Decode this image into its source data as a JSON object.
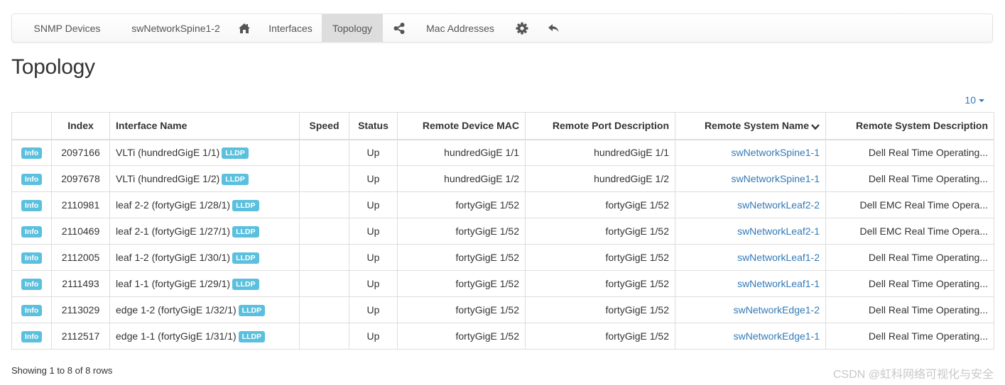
{
  "nav": {
    "snmp_devices": "SNMP Devices",
    "device_name": "swNetworkSpine1-2",
    "home_icon": "home-icon",
    "interfaces": "Interfaces",
    "topology": "Topology",
    "share_icon": "share-icon",
    "mac_addresses": "Mac Addresses",
    "gear_icon": "gear-icon",
    "back_icon": "reply-icon"
  },
  "page_title": "Topology",
  "page_size": "10",
  "table": {
    "columns": [
      "",
      "Index",
      "Interface Name",
      "Speed",
      "Status",
      "Remote Device MAC",
      "Remote Port Description",
      "Remote System Name",
      "Remote System Description"
    ],
    "info_label": "Info",
    "lldp_label": "LLDP",
    "rows": [
      {
        "index": "2097166",
        "iface": "VLTi (hundredGigE 1/1)",
        "speed": "",
        "status": "Up",
        "mac": "hundredGigE 1/1",
        "port_desc": "hundredGigE 1/1",
        "sys_name": "swNetworkSpine1-1",
        "sys_desc": "Dell Real Time Operating..."
      },
      {
        "index": "2097678",
        "iface": "VLTi (hundredGigE 1/2)",
        "speed": "",
        "status": "Up",
        "mac": "hundredGigE 1/2",
        "port_desc": "hundredGigE 1/2",
        "sys_name": "swNetworkSpine1-1",
        "sys_desc": "Dell Real Time Operating..."
      },
      {
        "index": "2110981",
        "iface": "leaf 2-2 (fortyGigE 1/28/1)",
        "speed": "",
        "status": "Up",
        "mac": "fortyGigE 1/52",
        "port_desc": "fortyGigE 1/52",
        "sys_name": "swNetworkLeaf2-2",
        "sys_desc": "Dell EMC Real Time Opera..."
      },
      {
        "index": "2110469",
        "iface": "leaf 2-1 (fortyGigE 1/27/1)",
        "speed": "",
        "status": "Up",
        "mac": "fortyGigE 1/52",
        "port_desc": "fortyGigE 1/52",
        "sys_name": "swNetworkLeaf2-1",
        "sys_desc": "Dell EMC Real Time Opera..."
      },
      {
        "index": "2112005",
        "iface": "leaf 1-2 (fortyGigE 1/30/1)",
        "speed": "",
        "status": "Up",
        "mac": "fortyGigE 1/52",
        "port_desc": "fortyGigE 1/52",
        "sys_name": "swNetworkLeaf1-2",
        "sys_desc": "Dell Real Time Operating..."
      },
      {
        "index": "2111493",
        "iface": "leaf 1-1 (fortyGigE 1/29/1)",
        "speed": "",
        "status": "Up",
        "mac": "fortyGigE 1/52",
        "port_desc": "fortyGigE 1/52",
        "sys_name": "swNetworkLeaf1-1",
        "sys_desc": "Dell Real Time Operating..."
      },
      {
        "index": "2113029",
        "iface": "edge 1-2 (fortyGigE 1/32/1)",
        "speed": "",
        "status": "Up",
        "mac": "fortyGigE 1/52",
        "port_desc": "fortyGigE 1/52",
        "sys_name": "swNetworkEdge1-2",
        "sys_desc": "Dell Real Time Operating..."
      },
      {
        "index": "2112517",
        "iface": "edge 1-1 (fortyGigE 1/31/1)",
        "speed": "",
        "status": "Up",
        "mac": "fortyGigE 1/52",
        "port_desc": "fortyGigE 1/52",
        "sys_name": "swNetworkEdge1-1",
        "sys_desc": "Dell Real Time Operating..."
      }
    ]
  },
  "footer": "Showing 1 to 8 of 8 rows",
  "watermark": "CSDN @虹科网络可视化与安全",
  "colors": {
    "link": "#337ab7",
    "status_up": "#3c763d",
    "badge": "#5bc0de",
    "nav_active": "#dddddd"
  }
}
